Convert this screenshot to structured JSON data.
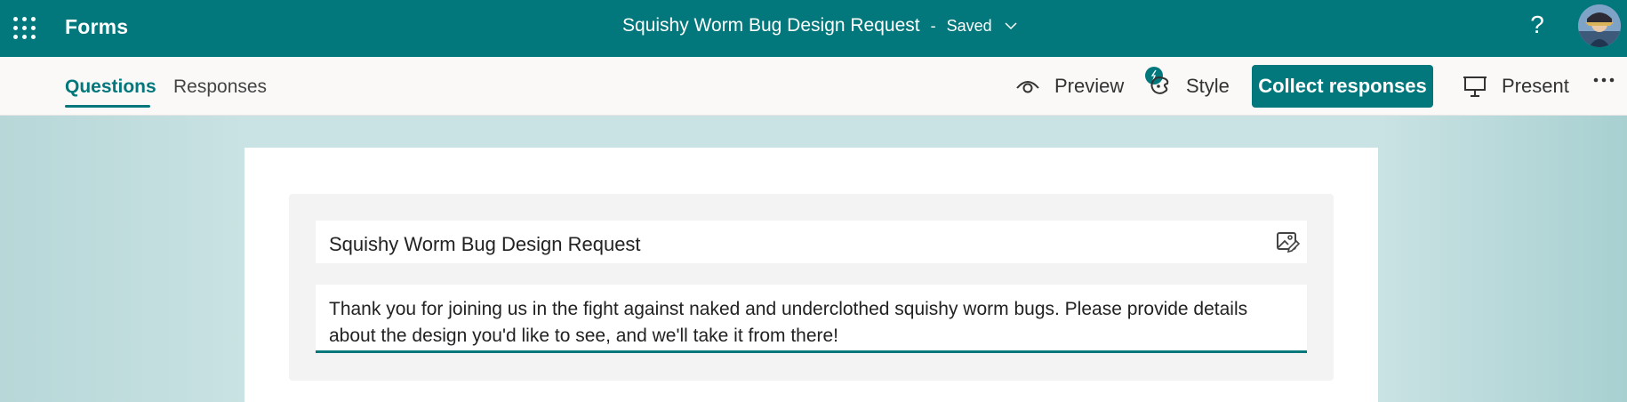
{
  "header": {
    "app_name": "Forms",
    "form_title": "Squishy Worm Bug Design Request",
    "separator": "-",
    "save_status": "Saved",
    "help_label": "?",
    "brand_color": "#03787c"
  },
  "tabs": [
    {
      "label": "Questions",
      "active": true
    },
    {
      "label": "Responses",
      "active": false
    }
  ],
  "commands": {
    "preview": "Preview",
    "style": "Style",
    "collect": "Collect responses",
    "present": "Present"
  },
  "icons": [
    "waffle-icon",
    "chevron-down-icon",
    "help-icon",
    "avatar",
    "eye-icon",
    "palette-icon",
    "present-icon",
    "more-icon",
    "image-edit-icon"
  ],
  "form": {
    "title": "Squishy Worm Bug Design Request",
    "description": "Thank you for joining us in the fight against naked and underclothed squishy worm bugs. Please provide details about the design you'd like to see, and we'll take it from there!"
  }
}
